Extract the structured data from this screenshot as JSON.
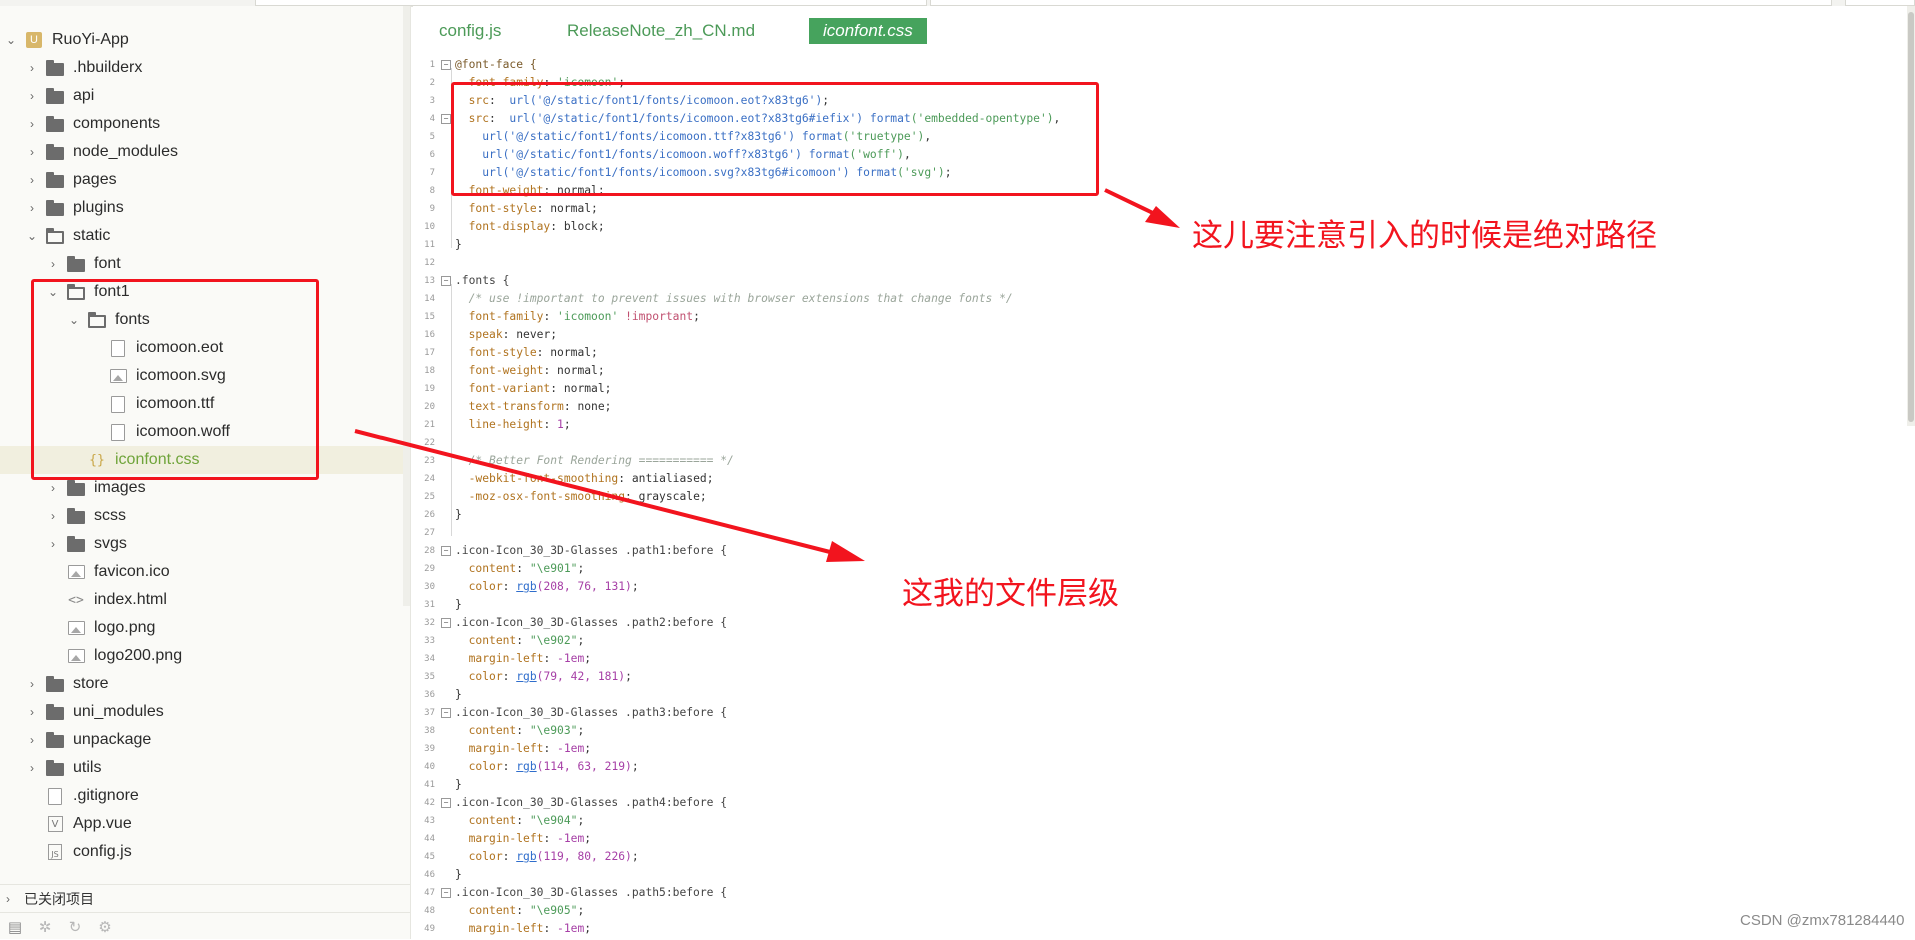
{
  "tree": {
    "project_name": "RuoYi-App",
    "items": [
      {
        "label": ".hbuilderx"
      },
      {
        "label": "api"
      },
      {
        "label": "components"
      },
      {
        "label": "node_modules"
      },
      {
        "label": "pages"
      },
      {
        "label": "plugins"
      },
      {
        "label": "static"
      },
      {
        "label": "font"
      },
      {
        "label": "font1"
      },
      {
        "label": "fonts"
      },
      {
        "label": "icomoon.eot"
      },
      {
        "label": "icomoon.svg"
      },
      {
        "label": "icomoon.ttf"
      },
      {
        "label": "icomoon.woff"
      },
      {
        "label": "iconfont.css"
      },
      {
        "label": "images"
      },
      {
        "label": "scss"
      },
      {
        "label": "svgs"
      },
      {
        "label": "favicon.ico"
      },
      {
        "label": "index.html"
      },
      {
        "label": "logo.png"
      },
      {
        "label": "logo200.png"
      },
      {
        "label": "store"
      },
      {
        "label": "uni_modules"
      },
      {
        "label": "unpackage"
      },
      {
        "label": "utils"
      },
      {
        "label": ".gitignore"
      },
      {
        "label": "App.vue"
      },
      {
        "label": "config.js"
      }
    ],
    "closed_projects": "已关闭项目"
  },
  "tabs": [
    "config.js",
    "ReleaseNote_zh_CN.md",
    "iconfont.css"
  ],
  "code": {
    "line_numbers": [
      "1",
      "2",
      "3",
      "4",
      "5",
      "6",
      "7",
      "8",
      "9",
      "10",
      "11",
      "12",
      "13",
      "14",
      "15",
      "16",
      "17",
      "18",
      "19",
      "20",
      "21",
      "22",
      "23",
      "24",
      "25",
      "26",
      "27",
      "28",
      "29",
      "30",
      "31",
      "32",
      "33",
      "34",
      "35",
      "36",
      "37",
      "38",
      "39",
      "40",
      "41",
      "42",
      "43",
      "44",
      "45",
      "46",
      "47",
      "48",
      "49"
    ],
    "ff_open": "@font-face {",
    "ff_family_p": "font-family",
    "ff_family_v": "'icomoon'",
    "src_p": "src",
    "url1": "url('@/static/font1/fonts/icomoon.eot?x83tg6')",
    "url2": "url('@/static/font1/fonts/icomoon.eot?x83tg6#iefix')",
    "fmt_fn": "format",
    "fmt2": "('embedded-opentype')",
    "url3": "url('@/static/font1/fonts/icomoon.ttf?x83tg6')",
    "fmt3": "('truetype')",
    "url4": "url('@/static/font1/fonts/icomoon.woff?x83tg6')",
    "fmt4": "('woff')",
    "url5": "url('@/static/font1/fonts/icomoon.svg?x83tg6#icomoon')",
    "fmt5": "('svg')",
    "fw_p": "font-weight",
    "normal": "normal",
    "fs_p": "font-style",
    "fd_p": "font-display",
    "block": "block",
    "close": "}",
    "fonts_sel": ".fonts {",
    "comment1": "/* use !important to prevent issues with browser extensions that change fonts */",
    "ff_v2": "'icomoon'",
    "important": "!important",
    "speak_p": "speak",
    "never": "never",
    "fv_p": "font-variant",
    "tt_p": "text-transform",
    "none": "none",
    "lh_p": "line-height",
    "one": "1",
    "comment2": "/* Better Font Rendering =========== */",
    "wfs_p": "-webkit-font-smoothing",
    "antialiased": "antialiased",
    "mfs_p": "-moz-osx-font-smoothing",
    "grayscale": "grayscale",
    "icon_base": ".icon-Icon_30_3D-Glasses",
    "p1": ".path1:before {",
    "p2": ".path2:before {",
    "p3": ".path3:before {",
    "p4": ".path4:before {",
    "p5": ".path5:before {",
    "content_p": "content",
    "c1": "\"\\e901\"",
    "c2": "\"\\e902\"",
    "c3": "\"\\e903\"",
    "c4": "\"\\e904\"",
    "c5": "\"\\e905\"",
    "color_p": "color",
    "ml_p": "margin-left",
    "ml_v": "-1em",
    "rgb": "rgb",
    "rgb1": "(208, 76, 131)",
    "rgb2": "(79, 42, 181)",
    "rgb3": "(114, 63, 219)",
    "rgb4": "(119, 80, 226)"
  },
  "annotations": {
    "absolute_path_note": "这儿要注意引入的时候是绝对路径",
    "file_hierarchy_note": "这我的文件层级",
    "color": "#f2141e"
  },
  "watermark": "CSDN @zmx781284440",
  "colors": {
    "active_tab": "#46a35d",
    "selected_row": "#f1efdf",
    "css_file": "#6fa43a"
  }
}
